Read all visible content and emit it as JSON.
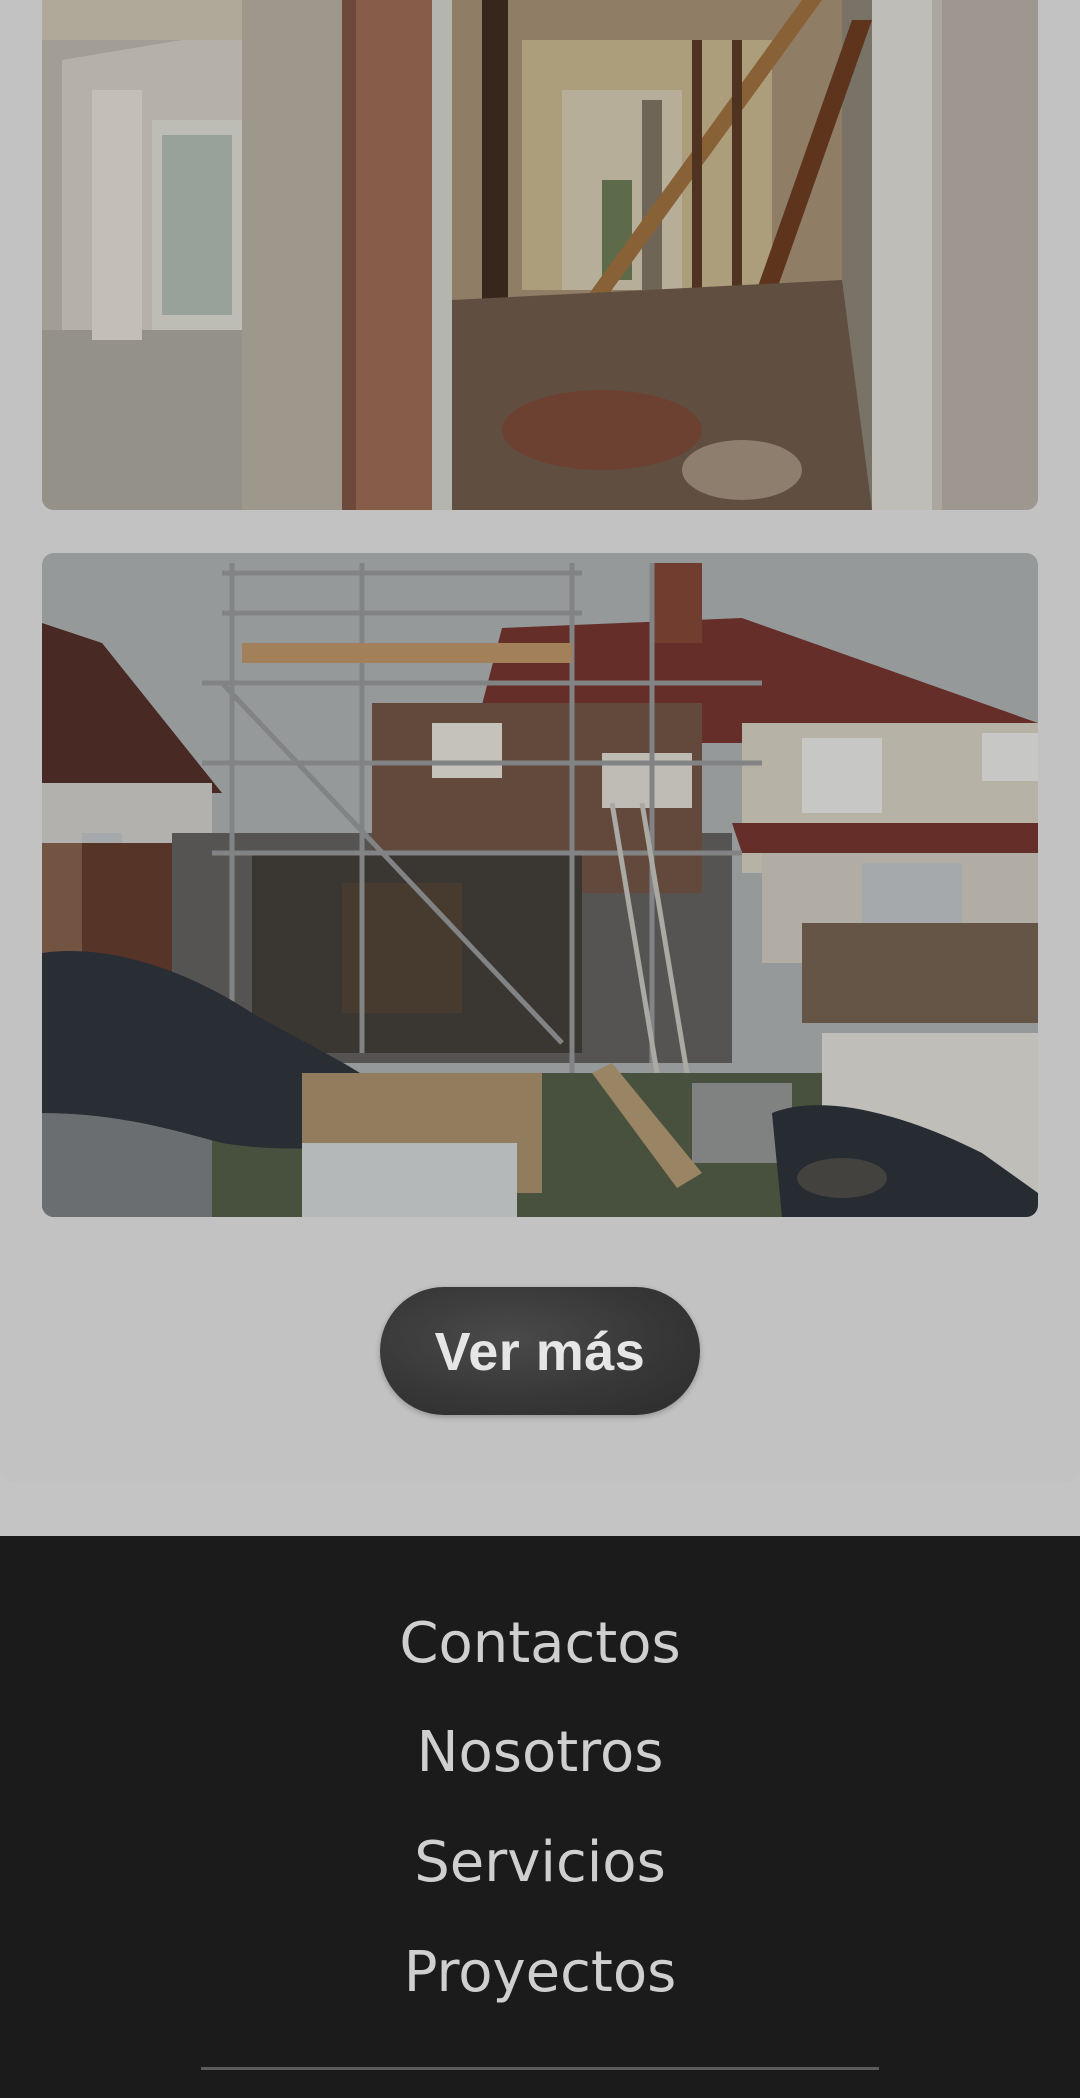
{
  "main": {
    "gallery": [
      {
        "name": "interior-renovation-photo"
      },
      {
        "name": "house-extension-scaffolding-photo"
      }
    ],
    "ver_mas_label": "Ver más"
  },
  "footer": {
    "links": [
      {
        "label": "Contactos"
      },
      {
        "label": "Nosotros"
      },
      {
        "label": "Servicios"
      },
      {
        "label": "Proyectos"
      }
    ]
  }
}
